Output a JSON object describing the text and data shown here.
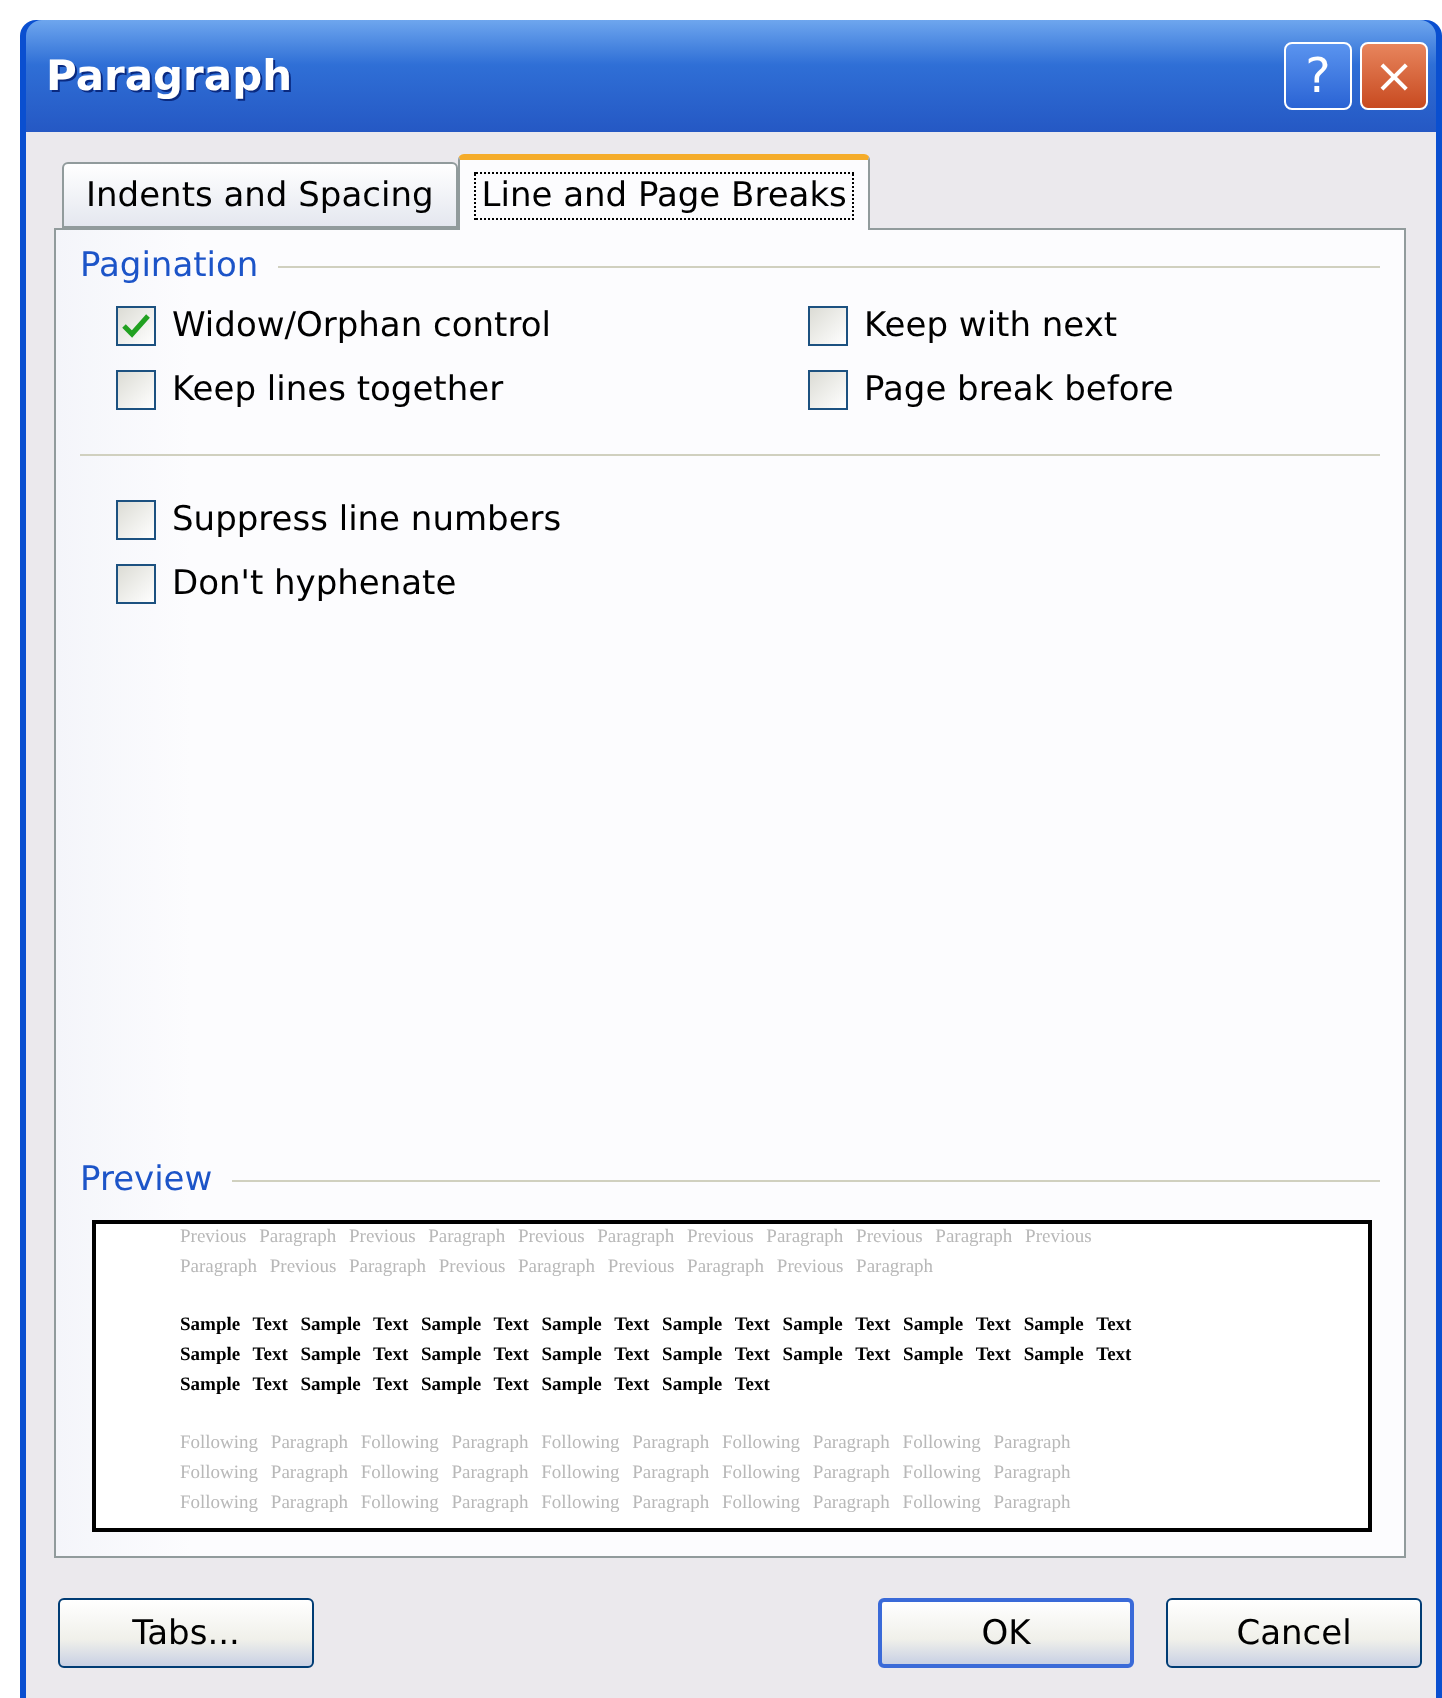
{
  "window": {
    "title": "Paragraph",
    "help_button": "?",
    "close_button": "×"
  },
  "tabs": [
    {
      "label": "Indents and Spacing",
      "selected": false
    },
    {
      "label": "Line and Page Breaks",
      "selected": true
    }
  ],
  "pagination": {
    "title": "Pagination",
    "options": [
      {
        "label": "Widow/Orphan control",
        "checked": true
      },
      {
        "label": "Keep with next",
        "checked": false
      },
      {
        "label": "Keep lines together",
        "checked": false
      },
      {
        "label": "Page break before",
        "checked": false
      }
    ]
  },
  "other_options": [
    {
      "label": "Suppress line numbers",
      "checked": false
    },
    {
      "label": "Don't hyphenate",
      "checked": false
    }
  ],
  "preview": {
    "title": "Preview",
    "previous_lines": [
      "Previous Paragraph Previous Paragraph Previous Paragraph Previous Paragraph Previous Paragraph Previous",
      "Paragraph Previous Paragraph Previous Paragraph Previous Paragraph Previous Paragraph"
    ],
    "sample_lines": [
      "Sample Text Sample Text Sample Text Sample Text Sample Text Sample Text Sample Text Sample Text",
      "Sample Text Sample Text Sample Text Sample Text Sample Text Sample Text Sample Text Sample Text",
      "Sample Text Sample Text Sample Text Sample Text Sample Text"
    ],
    "following_lines": [
      "Following Paragraph Following Paragraph Following Paragraph Following Paragraph Following Paragraph",
      "Following Paragraph Following Paragraph Following Paragraph Following Paragraph Following Paragraph",
      "Following Paragraph Following Paragraph Following Paragraph Following Paragraph Following Paragraph"
    ]
  },
  "buttons": [
    {
      "label": "Tabs...",
      "kind": "left"
    },
    {
      "label": "OK",
      "kind": "default"
    },
    {
      "label": "Cancel",
      "kind": "normal"
    }
  ]
}
